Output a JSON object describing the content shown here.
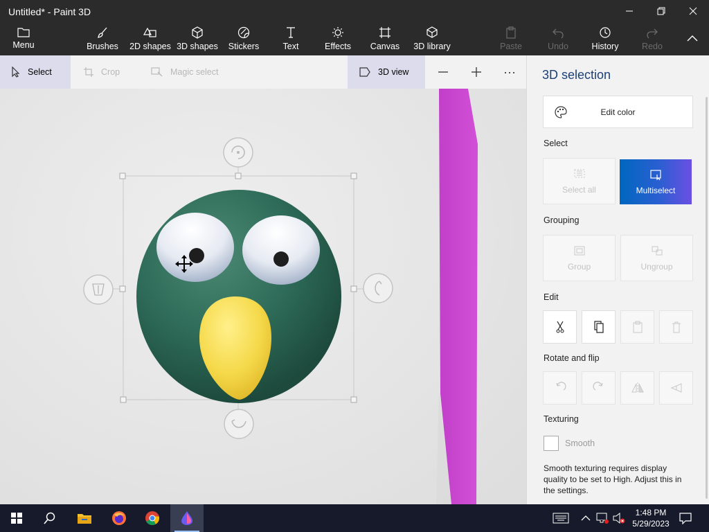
{
  "app": {
    "title": "Untitled* - Paint 3D"
  },
  "ribbon": {
    "menu_label": "Menu",
    "tools": [
      {
        "label": "Brushes"
      },
      {
        "label": "2D shapes"
      },
      {
        "label": "3D shapes"
      },
      {
        "label": "Stickers"
      },
      {
        "label": "Text"
      },
      {
        "label": "Effects"
      },
      {
        "label": "Canvas"
      },
      {
        "label": "3D library"
      }
    ],
    "paste_label": "Paste",
    "undo_label": "Undo",
    "history_label": "History",
    "redo_label": "Redo"
  },
  "toolbar": {
    "select_label": "Select",
    "crop_label": "Crop",
    "magic_select_label": "Magic select",
    "view3d_label": "3D view",
    "more_label": "···"
  },
  "panel": {
    "title": "3D selection",
    "edit_color_label": "Edit color",
    "select_heading": "Select",
    "select_all_label": "Select all",
    "multiselect_label": "Multiselect",
    "grouping_heading": "Grouping",
    "group_label": "Group",
    "ungroup_label": "Ungroup",
    "edit_heading": "Edit",
    "rotate_heading": "Rotate and flip",
    "texturing_heading": "Texturing",
    "smooth_label": "Smooth",
    "smooth_checked": false,
    "note": "Smooth texturing requires display quality to be set to High. Adjust this in the settings."
  },
  "taskbar": {
    "time": "1:48 PM",
    "date": "5/29/2023"
  },
  "colors": {
    "accent": "#0067c0",
    "model_green": "#2e6b58",
    "beak_yellow": "#f5d94a",
    "magenta_shape": "#cc44cc",
    "title_blue": "#1b3f78"
  }
}
